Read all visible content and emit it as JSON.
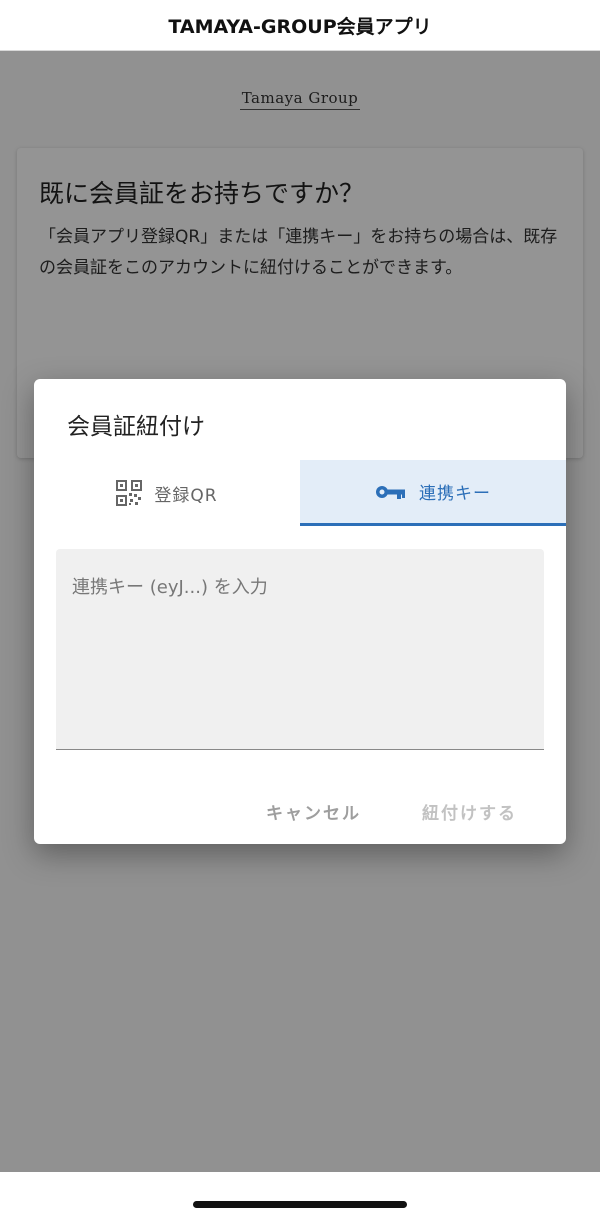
{
  "app": {
    "title": "TAMAYA-GROUP会員アプリ"
  },
  "logo": {
    "text": "Tamaya Group"
  },
  "card": {
    "title": "既に会員証をお持ちですか？",
    "description": "「会員アプリ登録QR」または「連携キー」をお持ちの場合は、既存の会員証をこのアカウントに紐付けることができます。"
  },
  "dialog": {
    "title": "会員証紐付け",
    "tabs": [
      {
        "label": "登録QR",
        "icon": "qr-code-icon",
        "selected": false
      },
      {
        "label": "連携キー",
        "icon": "key-icon",
        "selected": true
      }
    ],
    "input": {
      "placeholder": "連携キー (eyJ...) を入力",
      "value": ""
    },
    "actions": {
      "cancel_label": "キャンセル",
      "link_label": "紐付けする"
    }
  },
  "colors": {
    "accent": "#2c6fb8",
    "selected_tab_bg": "#e3edf8",
    "scrim": "rgba(0,0,0,0.42)"
  }
}
